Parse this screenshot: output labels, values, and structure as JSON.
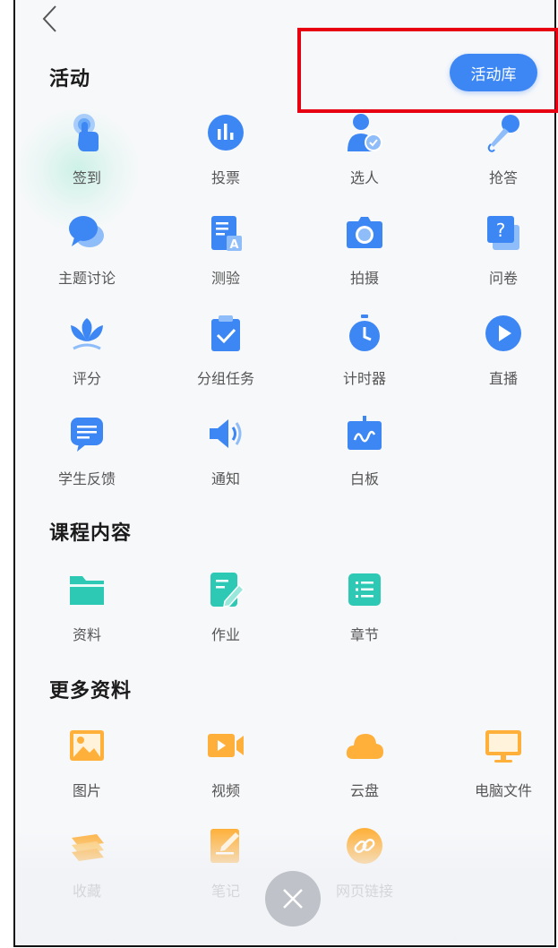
{
  "header": {
    "activity_library_label": "活动库"
  },
  "icons": {
    "back": "chevron-left-icon",
    "close": "close-icon"
  },
  "colors": {
    "blue": "#3d87f5",
    "teal": "#2ec9b5",
    "orange": "#ffb03a",
    "highlight": "#e60012"
  },
  "sections": [
    {
      "title": "活动",
      "items": [
        {
          "label": "签到",
          "icon": "tap-hand-icon"
        },
        {
          "label": "投票",
          "icon": "bar-chart-icon"
        },
        {
          "label": "选人",
          "icon": "user-check-icon"
        },
        {
          "label": "抢答",
          "icon": "microphone-icon"
        },
        {
          "label": "主题讨论",
          "icon": "chat-bubbles-icon"
        },
        {
          "label": "测验",
          "icon": "quiz-sheet-icon"
        },
        {
          "label": "拍摄",
          "icon": "camera-icon"
        },
        {
          "label": "问卷",
          "icon": "questionnaire-icon"
        },
        {
          "label": "评分",
          "icon": "lotus-icon"
        },
        {
          "label": "分组任务",
          "icon": "clipboard-check-icon"
        },
        {
          "label": "计时器",
          "icon": "stopwatch-icon"
        },
        {
          "label": "直播",
          "icon": "play-circle-icon"
        },
        {
          "label": "学生反馈",
          "icon": "feedback-icon"
        },
        {
          "label": "通知",
          "icon": "speaker-icon"
        },
        {
          "label": "白板",
          "icon": "whiteboard-icon"
        }
      ]
    },
    {
      "title": "课程内容",
      "items": [
        {
          "label": "资料",
          "icon": "folder-icon"
        },
        {
          "label": "作业",
          "icon": "edit-doc-icon"
        },
        {
          "label": "章节",
          "icon": "list-icon"
        }
      ]
    },
    {
      "title": "更多资料",
      "items": [
        {
          "label": "图片",
          "icon": "image-icon"
        },
        {
          "label": "视频",
          "icon": "video-icon"
        },
        {
          "label": "云盘",
          "icon": "cloud-icon"
        },
        {
          "label": "电脑文件",
          "icon": "monitor-icon"
        },
        {
          "label": "收藏",
          "icon": "layers-icon"
        },
        {
          "label": "笔记",
          "icon": "note-icon"
        },
        {
          "label": "网页链接",
          "icon": "link-icon"
        }
      ]
    }
  ]
}
